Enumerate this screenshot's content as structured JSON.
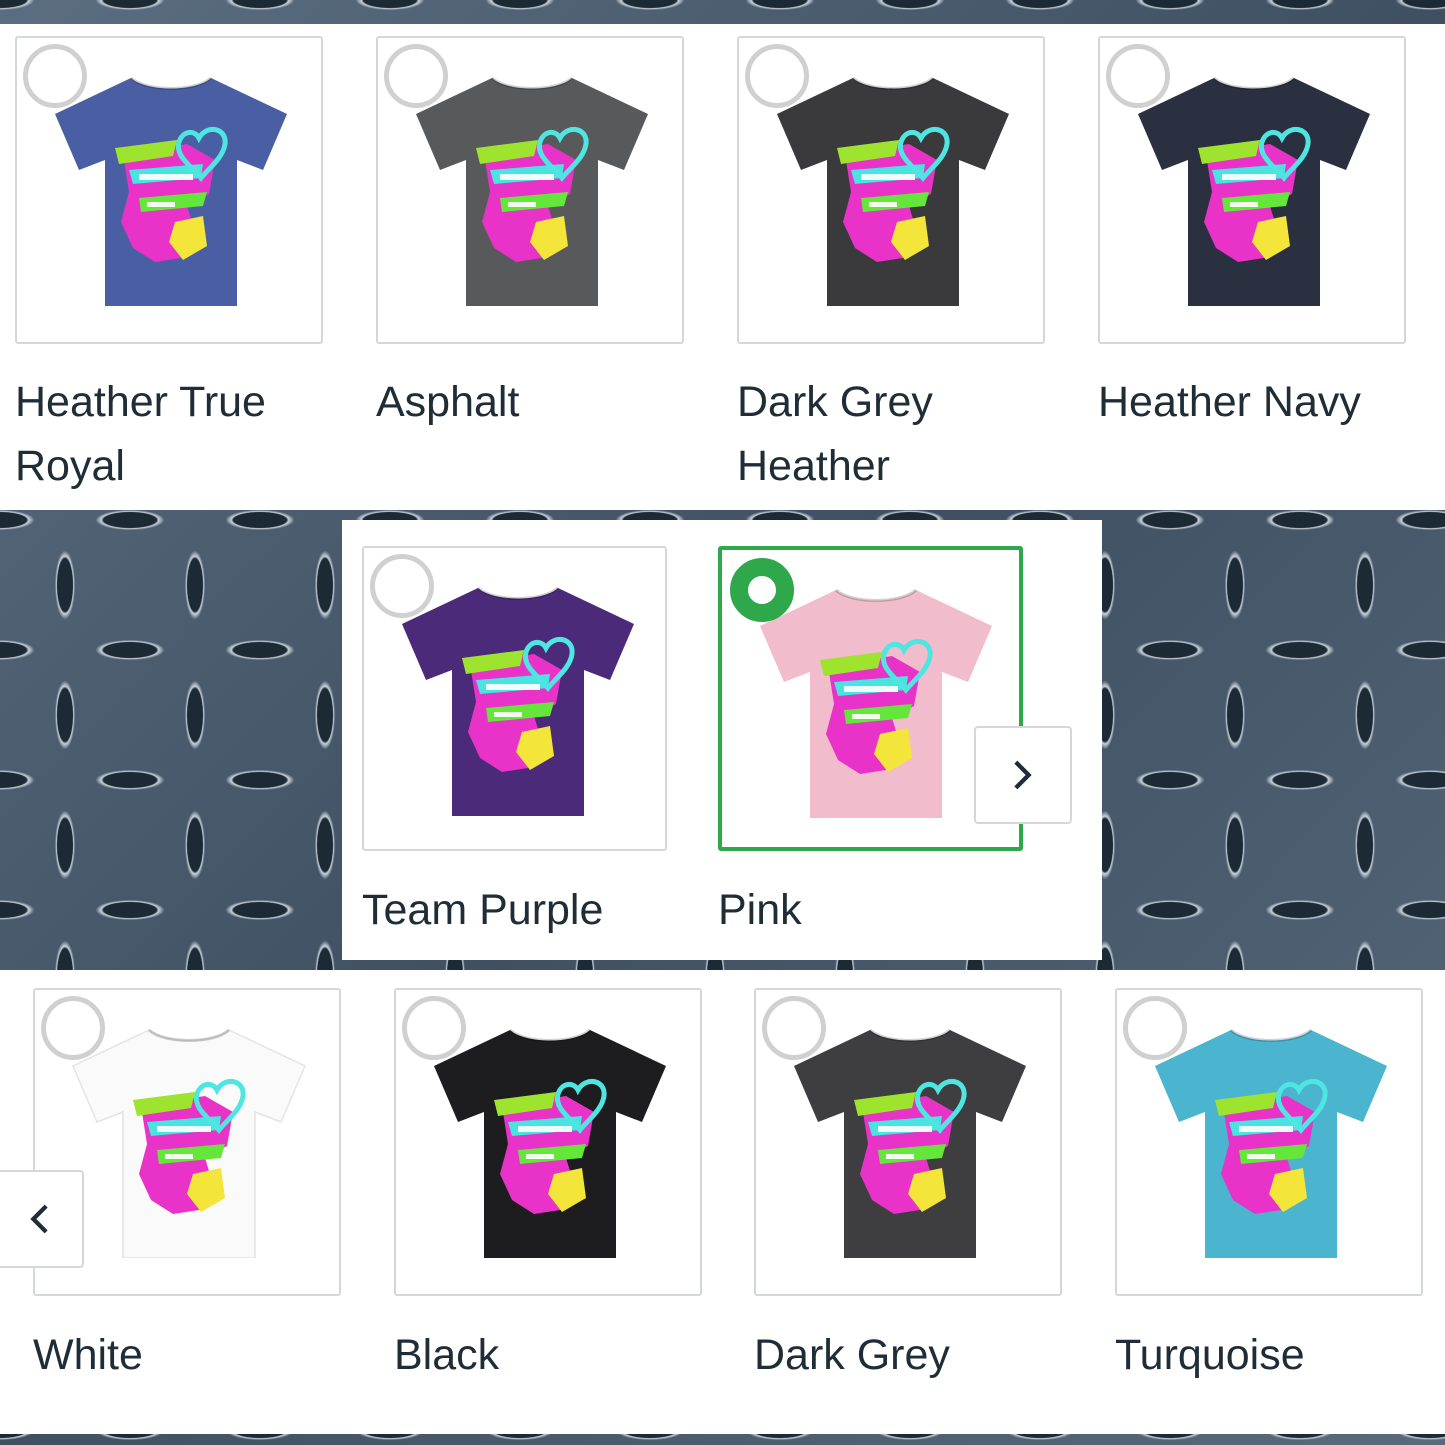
{
  "colors": {
    "selected_accent": "#2ea84a",
    "label_text": "#1f2d37",
    "card_border": "#d5d8db"
  },
  "swatches_top": [
    {
      "label": "Heather True Royal",
      "shirt_color": "#4a5fa3",
      "selected": false
    },
    {
      "label": "Asphalt",
      "shirt_color": "#58595b",
      "selected": false
    },
    {
      "label": "Dark Grey Heather",
      "shirt_color": "#3a3a3c",
      "selected": false
    },
    {
      "label": "Heather Navy",
      "shirt_color": "#2a3040",
      "selected": false
    }
  ],
  "swatches_mid": [
    {
      "label": "Team Purple",
      "shirt_color": "#4b2a7a",
      "selected": false
    },
    {
      "label": "Pink",
      "shirt_color": "#f1bccb",
      "selected": true
    }
  ],
  "swatches_bot": [
    {
      "label": "White",
      "shirt_color": "#fafafa",
      "selected": false
    },
    {
      "label": "Black",
      "shirt_color": "#1d1d1f",
      "selected": false
    },
    {
      "label": "Dark Grey",
      "shirt_color": "#3e3e40",
      "selected": false
    },
    {
      "label": "Turquoise",
      "shirt_color": "#4bb4cf",
      "selected": false
    }
  ],
  "icons": {
    "next": "chevron-right-icon",
    "prev": "chevron-left-icon",
    "radio": "radio-icon"
  }
}
